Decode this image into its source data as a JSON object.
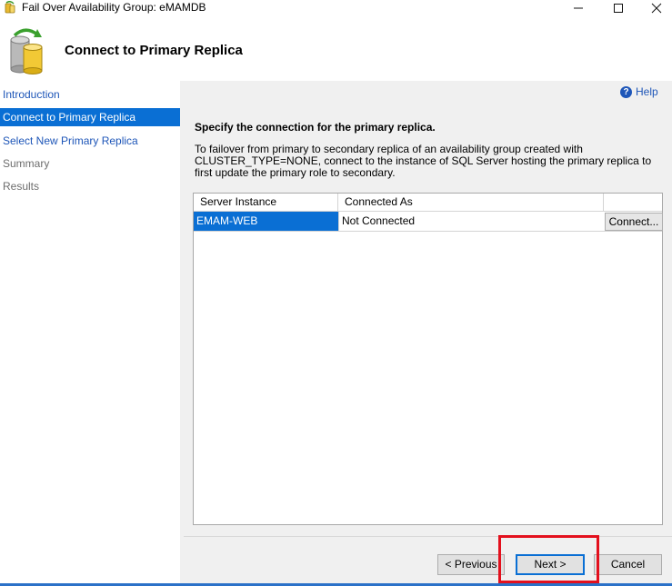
{
  "window": {
    "title": "Fail Over Availability Group: eMAMDB",
    "minimize_glyph": "—",
    "maximize_glyph": "☐",
    "close_glyph": "✕"
  },
  "header": {
    "title": "Connect to Primary Replica",
    "icon": "database-wizard-icon"
  },
  "nav": {
    "items": [
      {
        "label": "Introduction",
        "state": "link"
      },
      {
        "label": "Connect to Primary Replica",
        "state": "active"
      },
      {
        "label": "Select New Primary Replica",
        "state": "link"
      },
      {
        "label": "Summary",
        "state": "disabled"
      },
      {
        "label": "Results",
        "state": "disabled"
      }
    ]
  },
  "help": {
    "label": "Help",
    "icon_glyph": "?"
  },
  "content": {
    "heading": "Specify the connection for the primary replica.",
    "description": "To failover from primary to secondary replica of an availability group created with CLUSTER_TYPE=NONE, connect to the instance of SQL Server hosting the primary replica to first update the primary role to secondary."
  },
  "grid": {
    "columns": [
      "Server Instance",
      "Connected As",
      ""
    ],
    "rows": [
      {
        "server_instance": "EMAM-WEB",
        "connected_as": "Not Connected",
        "action_label": "Connect..."
      }
    ]
  },
  "footer": {
    "previous_label": "< Previous",
    "next_label": "Next >",
    "cancel_label": "Cancel"
  },
  "colors": {
    "accent": "#0a6fd4",
    "link": "#1e56b8",
    "highlight": "#e3101d"
  }
}
